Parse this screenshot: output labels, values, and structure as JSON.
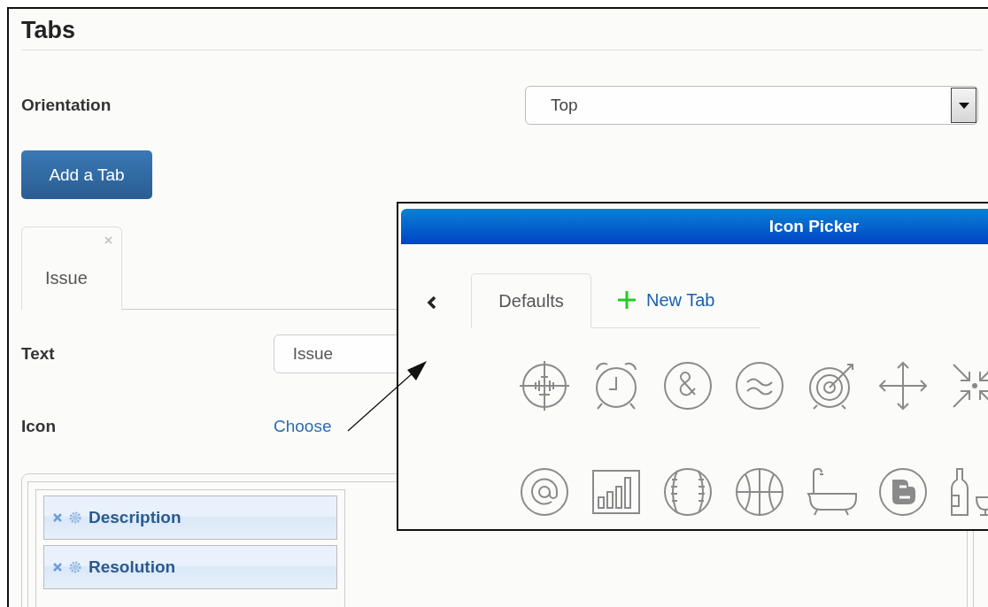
{
  "page": {
    "title": "Tabs"
  },
  "orientation": {
    "label": "Orientation",
    "value": "Top"
  },
  "add_button": {
    "label": "Add a Tab"
  },
  "tabs": [
    {
      "label": "Issue",
      "selected": true
    }
  ],
  "text_field": {
    "label": "Text",
    "value": "Issue"
  },
  "icon_field": {
    "label": "Icon",
    "link": "Choose"
  },
  "layout_fields": [
    {
      "label": "Description"
    },
    {
      "label": "Resolution"
    }
  ],
  "dialog": {
    "title": "Icon Picker",
    "tabs": [
      {
        "label": "Defaults",
        "selected": true
      }
    ],
    "new_tab": "New Tab"
  }
}
